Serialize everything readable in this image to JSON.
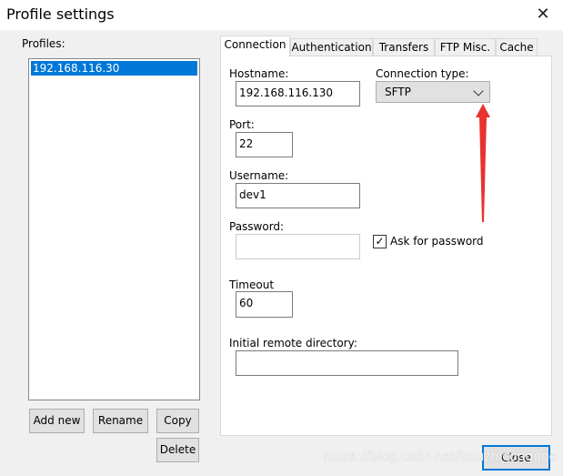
{
  "window": {
    "title": "Profile settings",
    "close_icon": "close-icon"
  },
  "profiles": {
    "label": "Profiles:",
    "items": [
      "192.168.116.30"
    ],
    "selected": 0
  },
  "buttons": {
    "add_new": "Add new",
    "rename": "Rename",
    "copy": "Copy",
    "delete": "Delete",
    "close": "Close"
  },
  "tabs": [
    "Connection",
    "Authentication",
    "Transfers",
    "FTP Misc.",
    "Cache"
  ],
  "active_tab": "Connection",
  "form": {
    "hostname_label": "Hostname:",
    "hostname": "192.168.116.130",
    "connection_type_label": "Connection type:",
    "connection_type": "SFTP",
    "port_label": "Port:",
    "port": "22",
    "username_label": "Username:",
    "username": "dev1",
    "password_label": "Password:",
    "password": "",
    "ask_password_label": "Ask for password",
    "ask_password_checked": true,
    "timeout_label": "Timeout",
    "timeout": "60",
    "initial_dir_label": "Initial remote directory:",
    "initial_dir": ""
  },
  "annotation": {
    "arrow_color": "#e8322f"
  },
  "watermark": "https://blog.csdn.net/houzhicongone",
  "colors": {
    "accent": "#0078d7"
  }
}
